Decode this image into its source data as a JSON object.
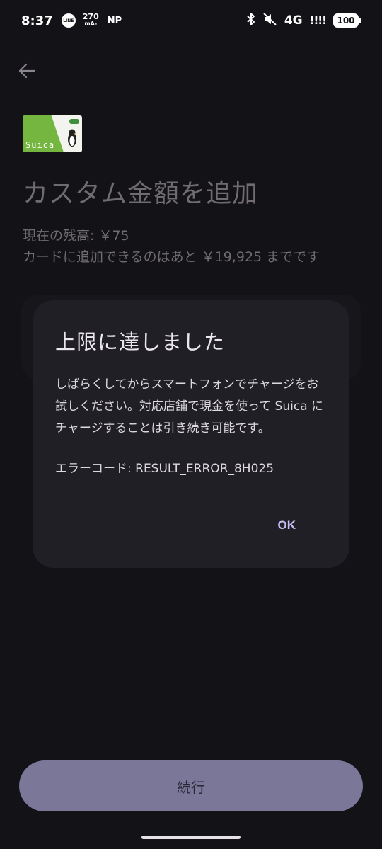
{
  "status_bar": {
    "time": "8:37",
    "line_label": "LINE",
    "speed_value": "270",
    "speed_unit": "mA-",
    "carrier": "NP",
    "network": "4G",
    "signal": "!!!!",
    "battery": "100"
  },
  "icons": {
    "back": "arrow-left-icon",
    "bluetooth": "bluetooth-icon",
    "mute": "volume-off-icon"
  },
  "card": {
    "name": "Suica"
  },
  "page": {
    "title": "カスタム金額を追加",
    "balance": "現在の残高: ￥75",
    "limit": "カードに追加できるのはあと ￥19,925 までです"
  },
  "dialog": {
    "title": "上限に達しました",
    "body": "しばらくしてからスマートフォンでチャージをお試しください。対応店舗で現金を使って Suica にチャージすることは引き続き可能です。",
    "error_code": "エラーコード: RESULT_ERROR_8H025",
    "ok_label": "OK"
  },
  "footer": {
    "continue_label": "続行"
  },
  "colors": {
    "background": "#131217",
    "dialog_bg": "#201f25",
    "accent": "#c7bff5",
    "button_bg": "#7a7799",
    "suica_green": "#74b640"
  }
}
